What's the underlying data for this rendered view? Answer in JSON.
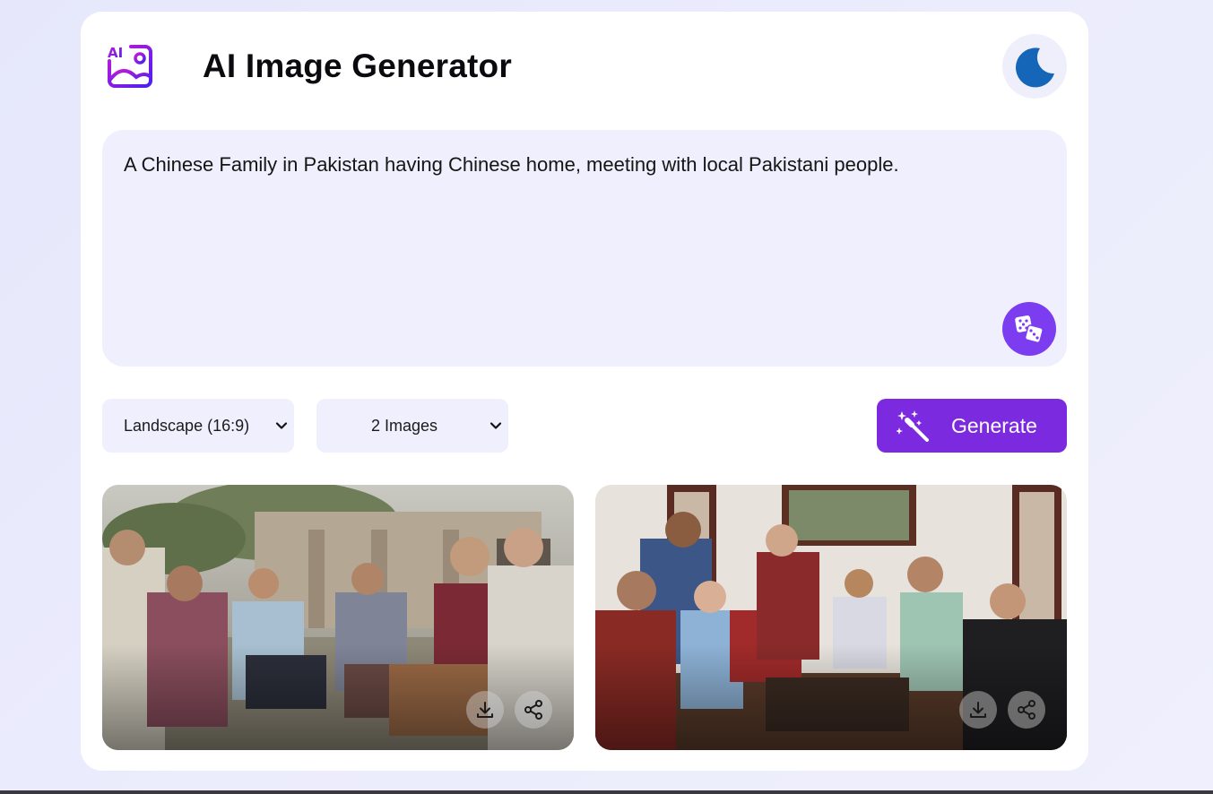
{
  "app": {
    "title": "AI Image Generator",
    "logo_icon": "ai-image-logo-icon",
    "logo_text": "AI",
    "theme_toggle_icon": "moon-icon"
  },
  "prompt": {
    "text": "A Chinese Family in Pakistan having Chinese home, meeting with local Pakistani people.",
    "random_button_icon": "dice-icon"
  },
  "options": {
    "aspect_ratio": {
      "selected": "Landscape (16:9)"
    },
    "image_count": {
      "selected": "2 Images"
    }
  },
  "generate": {
    "label": "Generate",
    "icon": "magic-wand-icon"
  },
  "results": [
    {
      "description_icon": "generated-image",
      "actions": [
        "download-icon",
        "share-icon"
      ]
    },
    {
      "description_icon": "generated-image",
      "actions": [
        "download-icon",
        "share-icon"
      ]
    }
  ],
  "colors": {
    "accent": "#7c2ae0",
    "dice_button": "#7c3cf0",
    "panel": "#efeffd",
    "moon": "#1565b8"
  }
}
